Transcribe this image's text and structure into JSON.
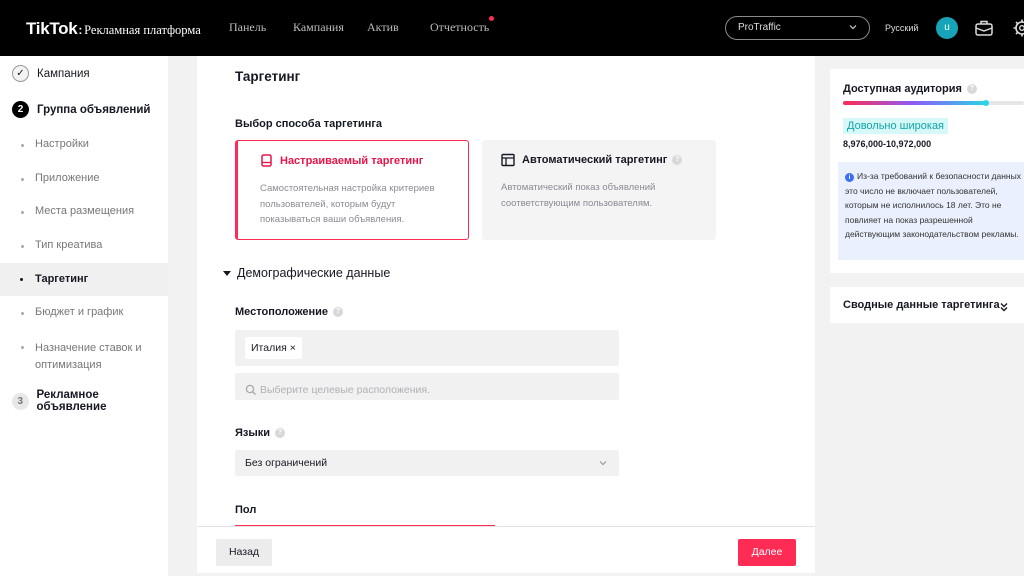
{
  "topbar": {
    "brand_logo": "TikTok",
    "brand_separator": ":",
    "brand_subtitle": "Рекламная платформа",
    "nav": [
      "Панель",
      "Кампания",
      "Актив",
      "Отчетность"
    ],
    "account": "ProTraffic",
    "language": "Русский",
    "avatar_letter": "u",
    "icons": [
      "chevron-down-icon",
      "briefcase-icon",
      "gear-icon"
    ]
  },
  "sidebar": {
    "steps": [
      {
        "label": "Кампания",
        "marker": "✓",
        "state": "done"
      },
      {
        "label": "Группа объявлений",
        "marker": "2",
        "state": "active"
      },
      {
        "label": "Рекламное объявление",
        "marker": "3",
        "state": "todo"
      }
    ],
    "substeps": [
      "Настройки",
      "Приложение",
      "Места размещения",
      "Тип креатива",
      "Таргетинг",
      "Бюджет и график",
      "Назначение ставок и оптимизация"
    ],
    "active_substep": "Таргетинг"
  },
  "main": {
    "title": "Таргетинг",
    "method_label": "Выбор способа таргетинга",
    "cards": [
      {
        "title": "Настраиваемый таргетинг",
        "desc": "Самостоятельная настройка критериев пользователей, которым будут показываться ваши объявления.",
        "selected": true
      },
      {
        "title": "Автоматический таргетинг",
        "desc": "Автоматический показ объявлений соответствующим пользователям.",
        "selected": false
      }
    ],
    "demographics": "Демографические данные",
    "location": {
      "label": "Местоположение",
      "tag": "Италия",
      "tag_remove": "×",
      "placeholder": "Выберите целевые расположения."
    },
    "languages": {
      "label": "Языки",
      "value": "Без ограничений"
    },
    "gender": {
      "label": "Пол"
    }
  },
  "footer": {
    "back": "Назад",
    "next": "Далее"
  },
  "audience": {
    "title": "Доступная аудитория",
    "breadth_level": 0.79,
    "status": "Довольно широкая",
    "range": "8,976,000-10,972,000",
    "note_icon": "i",
    "note": "Из-за требований к безопасности данных это число не включает пользователей, которым не исполнилось 18 лет. Это не повлияет на показ разрешенной действующим законодательством рекламы.",
    "accent": "#fe2c55"
  },
  "summary": {
    "title": "Сводные данные таргетинга"
  }
}
